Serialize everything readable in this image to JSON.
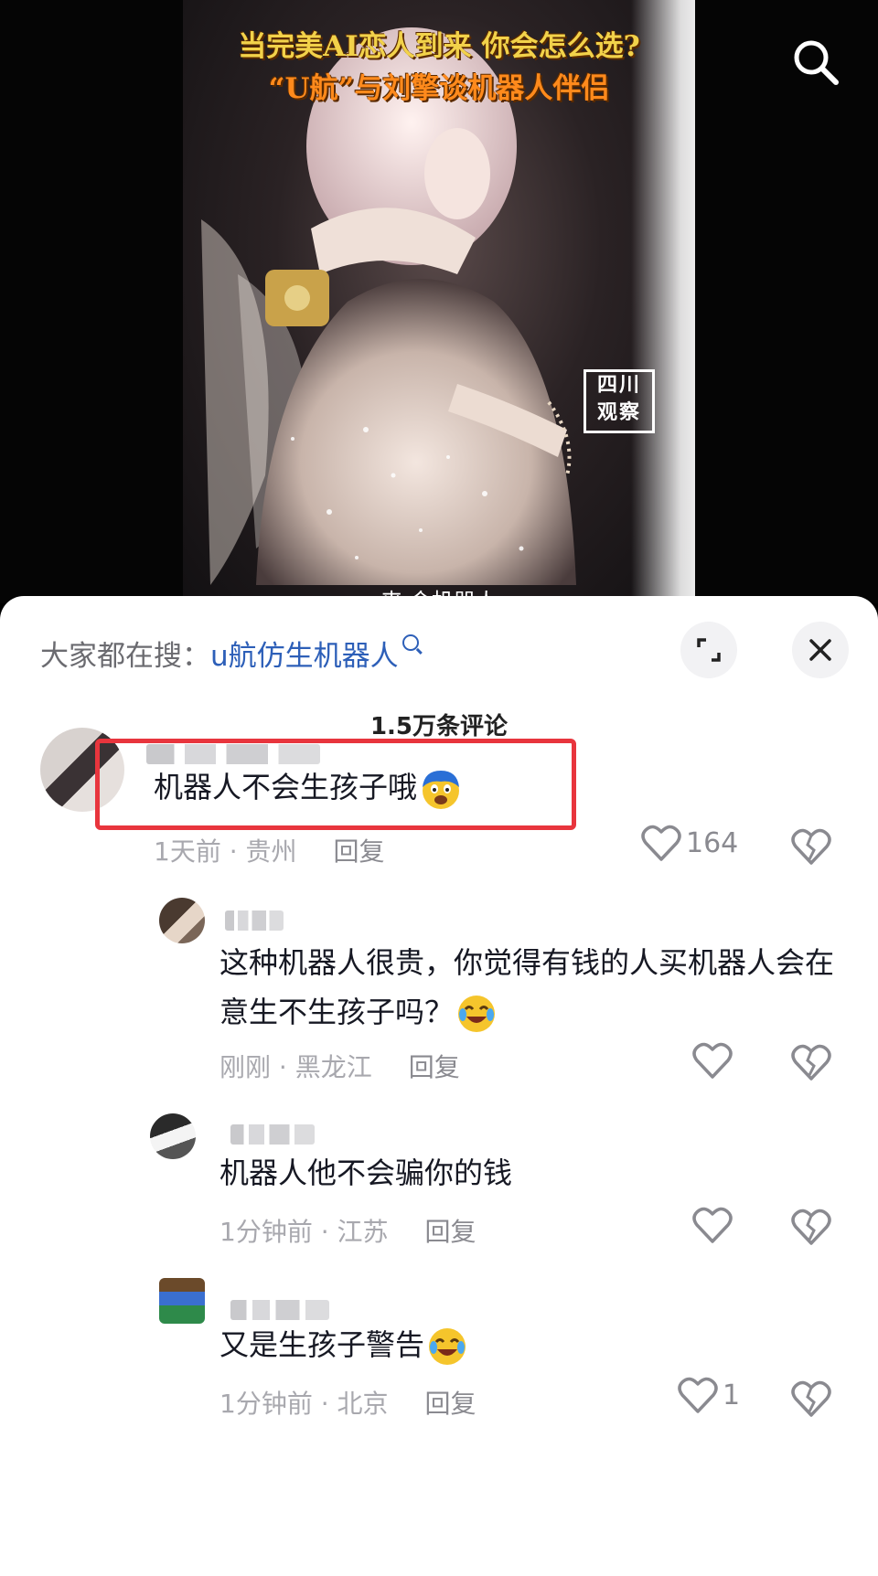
{
  "video": {
    "title_line1": "当完美AI恋人到来 你会怎么选?",
    "title_line2": "“U航”与刘擎谈机器人伴侣",
    "watermark_line1": "四川",
    "watermark_line2": "观察",
    "caption": "来 会机器人"
  },
  "sheet": {
    "hot_search_prefix": "大家都在搜：",
    "hot_search_keyword": "u航仿生机器人",
    "comment_count": "1.5万条评论"
  },
  "comments": [
    {
      "text": "机器人不会生孩子哦",
      "time": "1天前",
      "location": "贵州",
      "reply_label": "回复",
      "likes": "164"
    },
    {
      "text": "这种机器人很贵，你觉得有钱的人买机器人会在意生不生孩子吗？",
      "time": "刚刚",
      "location": "黑龙江",
      "reply_label": "回复",
      "likes": ""
    },
    {
      "text": "机器人他不会骗你的钱",
      "time": "1分钟前",
      "location": "江苏",
      "reply_label": "回复",
      "likes": ""
    },
    {
      "text": "又是生孩子警告",
      "time": "1分钟前",
      "location": "北京",
      "reply_label": "回复",
      "likes": "1"
    }
  ],
  "icons": {
    "search": "search-icon",
    "expand": "expand-icon",
    "close": "close-icon",
    "like": "heart-icon",
    "dislike": "broken-heart-icon"
  },
  "colors": {
    "highlight_border": "#e8353d",
    "keyword_link": "#2d5fb8",
    "title_yellow": "#f2d24a",
    "title_orange": "#ff8a1c"
  }
}
